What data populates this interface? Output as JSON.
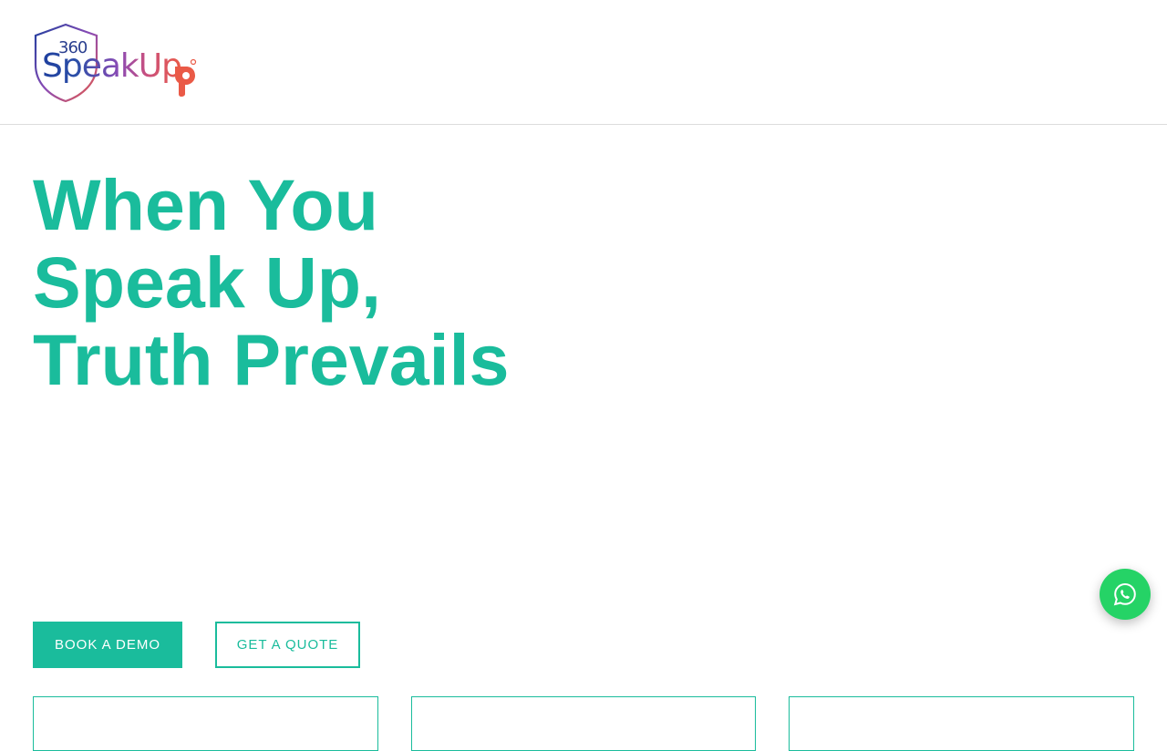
{
  "brand": {
    "logo_number": "360",
    "logo_word": "SpeakUp",
    "colors": {
      "accent": "#1abc9c",
      "logo_blue": "#1e3f9e",
      "logo_purple": "#8a4bb5",
      "logo_orange": "#ea5a47",
      "whatsapp": "#25d366"
    }
  },
  "hero": {
    "title_lines": [
      "When You",
      "Speak Up,",
      "Truth Prevails"
    ]
  },
  "buttons": {
    "book_demo": "BOOK A DEMO",
    "get_quote": "GET A QUOTE"
  },
  "floating": {
    "whatsapp_icon": "whatsapp-icon"
  }
}
